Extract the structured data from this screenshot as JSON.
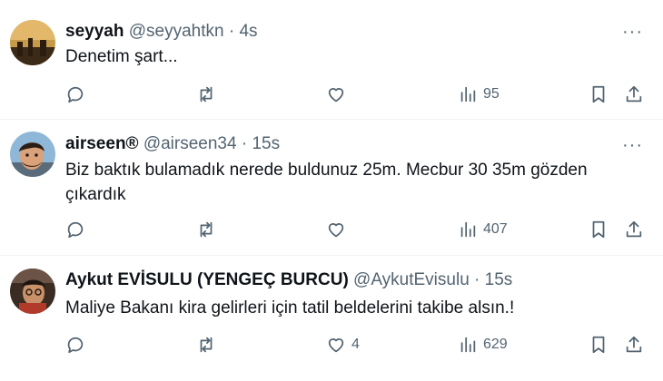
{
  "tweets": [
    {
      "name": "seyyah",
      "handle": "@seyyahtkn",
      "dot": "·",
      "time": "4s",
      "text": "Denetim şart...",
      "likes": "",
      "views": "95",
      "avatar_icon": "avatar-photo-icon"
    },
    {
      "name": "airseen®",
      "handle": "@airseen34",
      "dot": "·",
      "time": "15s",
      "text": "Biz baktık bulamadık nerede buldunuz 25m. Mecbur 30 35m gözden çıkardık",
      "likes": "",
      "views": "407",
      "avatar_icon": "avatar-photo-icon"
    },
    {
      "name": "Aykut EVİSULU (YENGEÇ BURCU)",
      "handle": "@AykutEvisulu",
      "dot": "·",
      "time": "15s",
      "text": "Maliye Bakanı kira gelirleri için tatil beldelerini takibe alsın.!",
      "likes": "4",
      "views": "629",
      "avatar_icon": "avatar-photo-icon"
    }
  ],
  "more_label": "···",
  "icons": [
    "reply-icon",
    "retweet-icon",
    "like-icon",
    "views-icon",
    "bookmark-icon",
    "share-icon"
  ],
  "colors": {
    "text": "#0f1419",
    "secondary": "#536471",
    "divider": "#eff3f4"
  }
}
